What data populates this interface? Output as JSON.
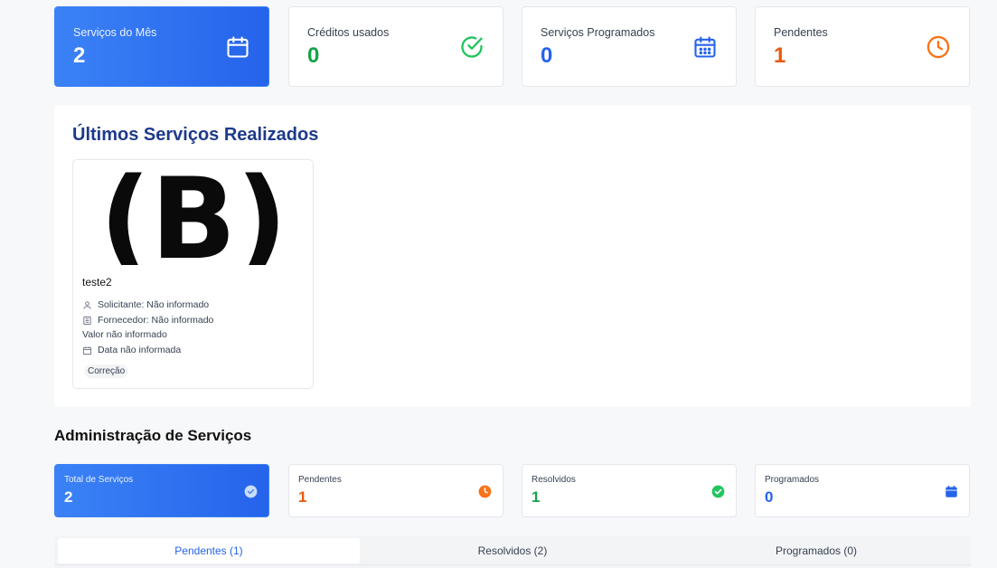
{
  "stats": [
    {
      "label": "Serviços do Mês",
      "value": "2",
      "icon": "calendar-icon"
    },
    {
      "label": "Créditos usados",
      "value": "0",
      "icon": "check-circle-icon"
    },
    {
      "label": "Serviços Programados",
      "value": "0",
      "icon": "calendar-grid-icon"
    },
    {
      "label": "Pendentes",
      "value": "1",
      "icon": "clock-icon"
    }
  ],
  "recent": {
    "title": "Últimos Serviços Realizados",
    "card": {
      "logo_text": "(B)",
      "name": "teste2",
      "requester": "Solicitante: Não informado",
      "supplier": "Fornecedor: Não informado",
      "value": "Valor não informado",
      "date": "Data não informada",
      "tag": "Correção"
    }
  },
  "admin": {
    "title": "Administração de Serviços",
    "stats": [
      {
        "label": "Total de Serviços",
        "value": "2"
      },
      {
        "label": "Pendentes",
        "value": "1"
      },
      {
        "label": "Resolvidos",
        "value": "1"
      },
      {
        "label": "Programados",
        "value": "0"
      }
    ],
    "tabs": [
      "Pendentes (1)",
      "Resolvidos (2)",
      "Programados (0)"
    ]
  },
  "colors": {
    "blue": "#2563eb",
    "green": "#16a34a",
    "orange": "#ea580c",
    "navy": "#1e3a8a"
  }
}
